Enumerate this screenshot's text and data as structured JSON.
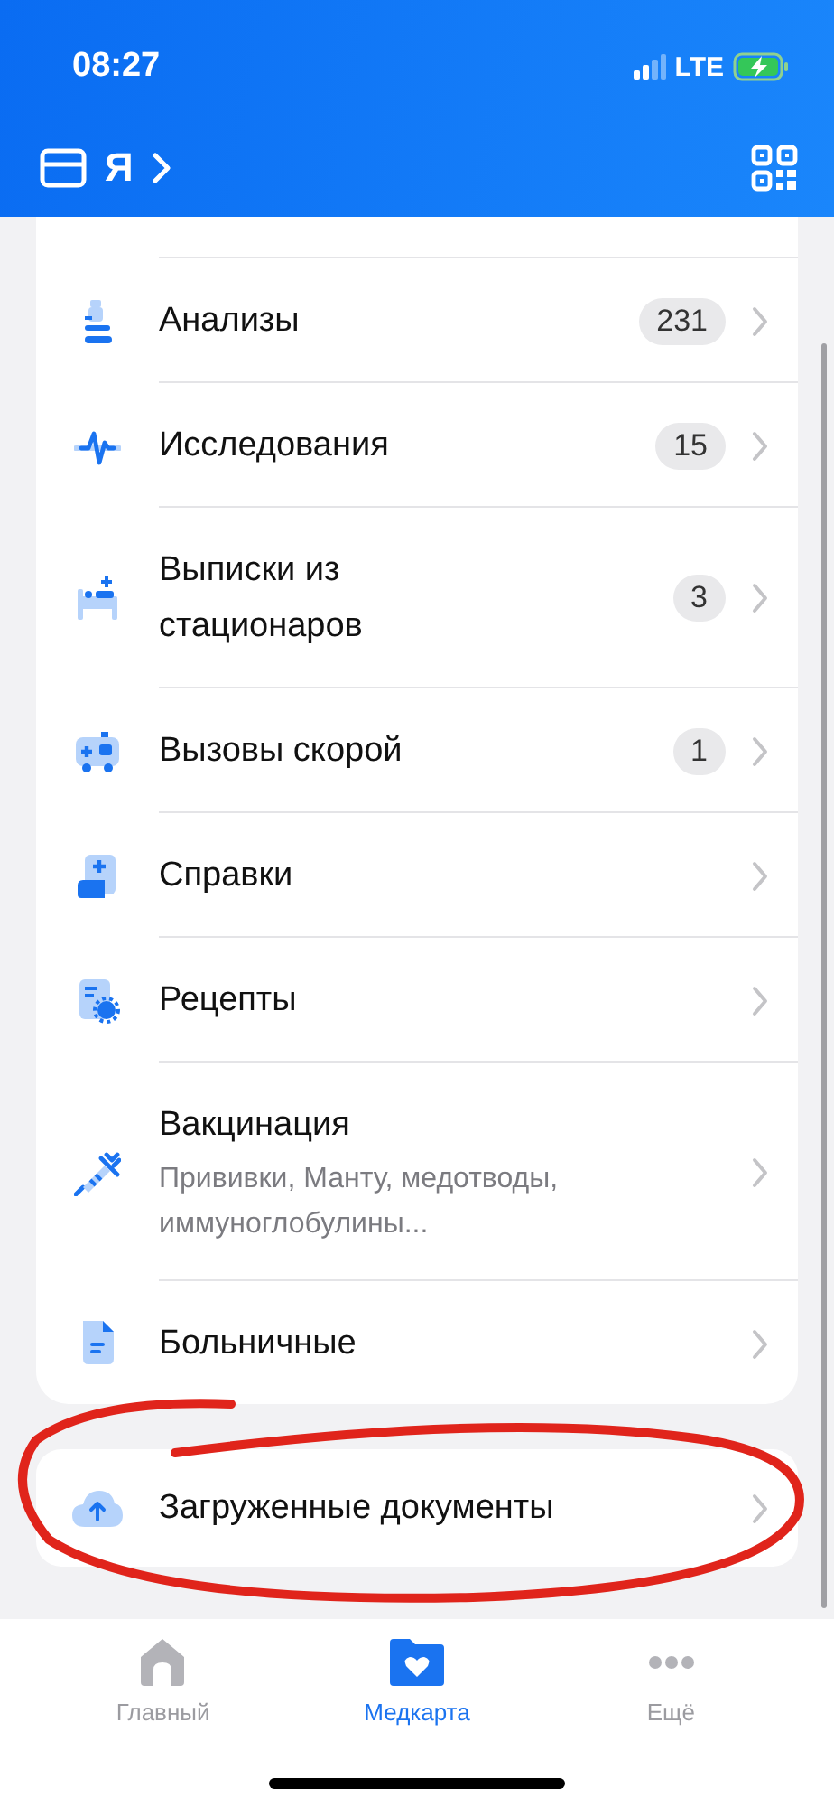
{
  "status_bar": {
    "time": "08:27",
    "network": "LTE"
  },
  "header": {
    "profile": "Я"
  },
  "records": [
    {
      "title": "Анализы",
      "count": "231"
    },
    {
      "title": "Исследования",
      "count": "15"
    },
    {
      "title": "Выписки из стационаров",
      "count": "3"
    },
    {
      "title": "Вызовы скорой",
      "count": "1"
    },
    {
      "title": "Справки"
    },
    {
      "title": "Рецепты"
    },
    {
      "title": "Вакцинация",
      "subtitle": "Прививки, Манту, медотводы, иммуноглобулины..."
    },
    {
      "title": "Больничные"
    }
  ],
  "uploads": {
    "title": "Загруженные документы"
  },
  "tab_bar": [
    {
      "label": "Главный",
      "selected": false
    },
    {
      "label": "Медкарта",
      "selected": true
    },
    {
      "label": "Ещё",
      "selected": false
    }
  ]
}
